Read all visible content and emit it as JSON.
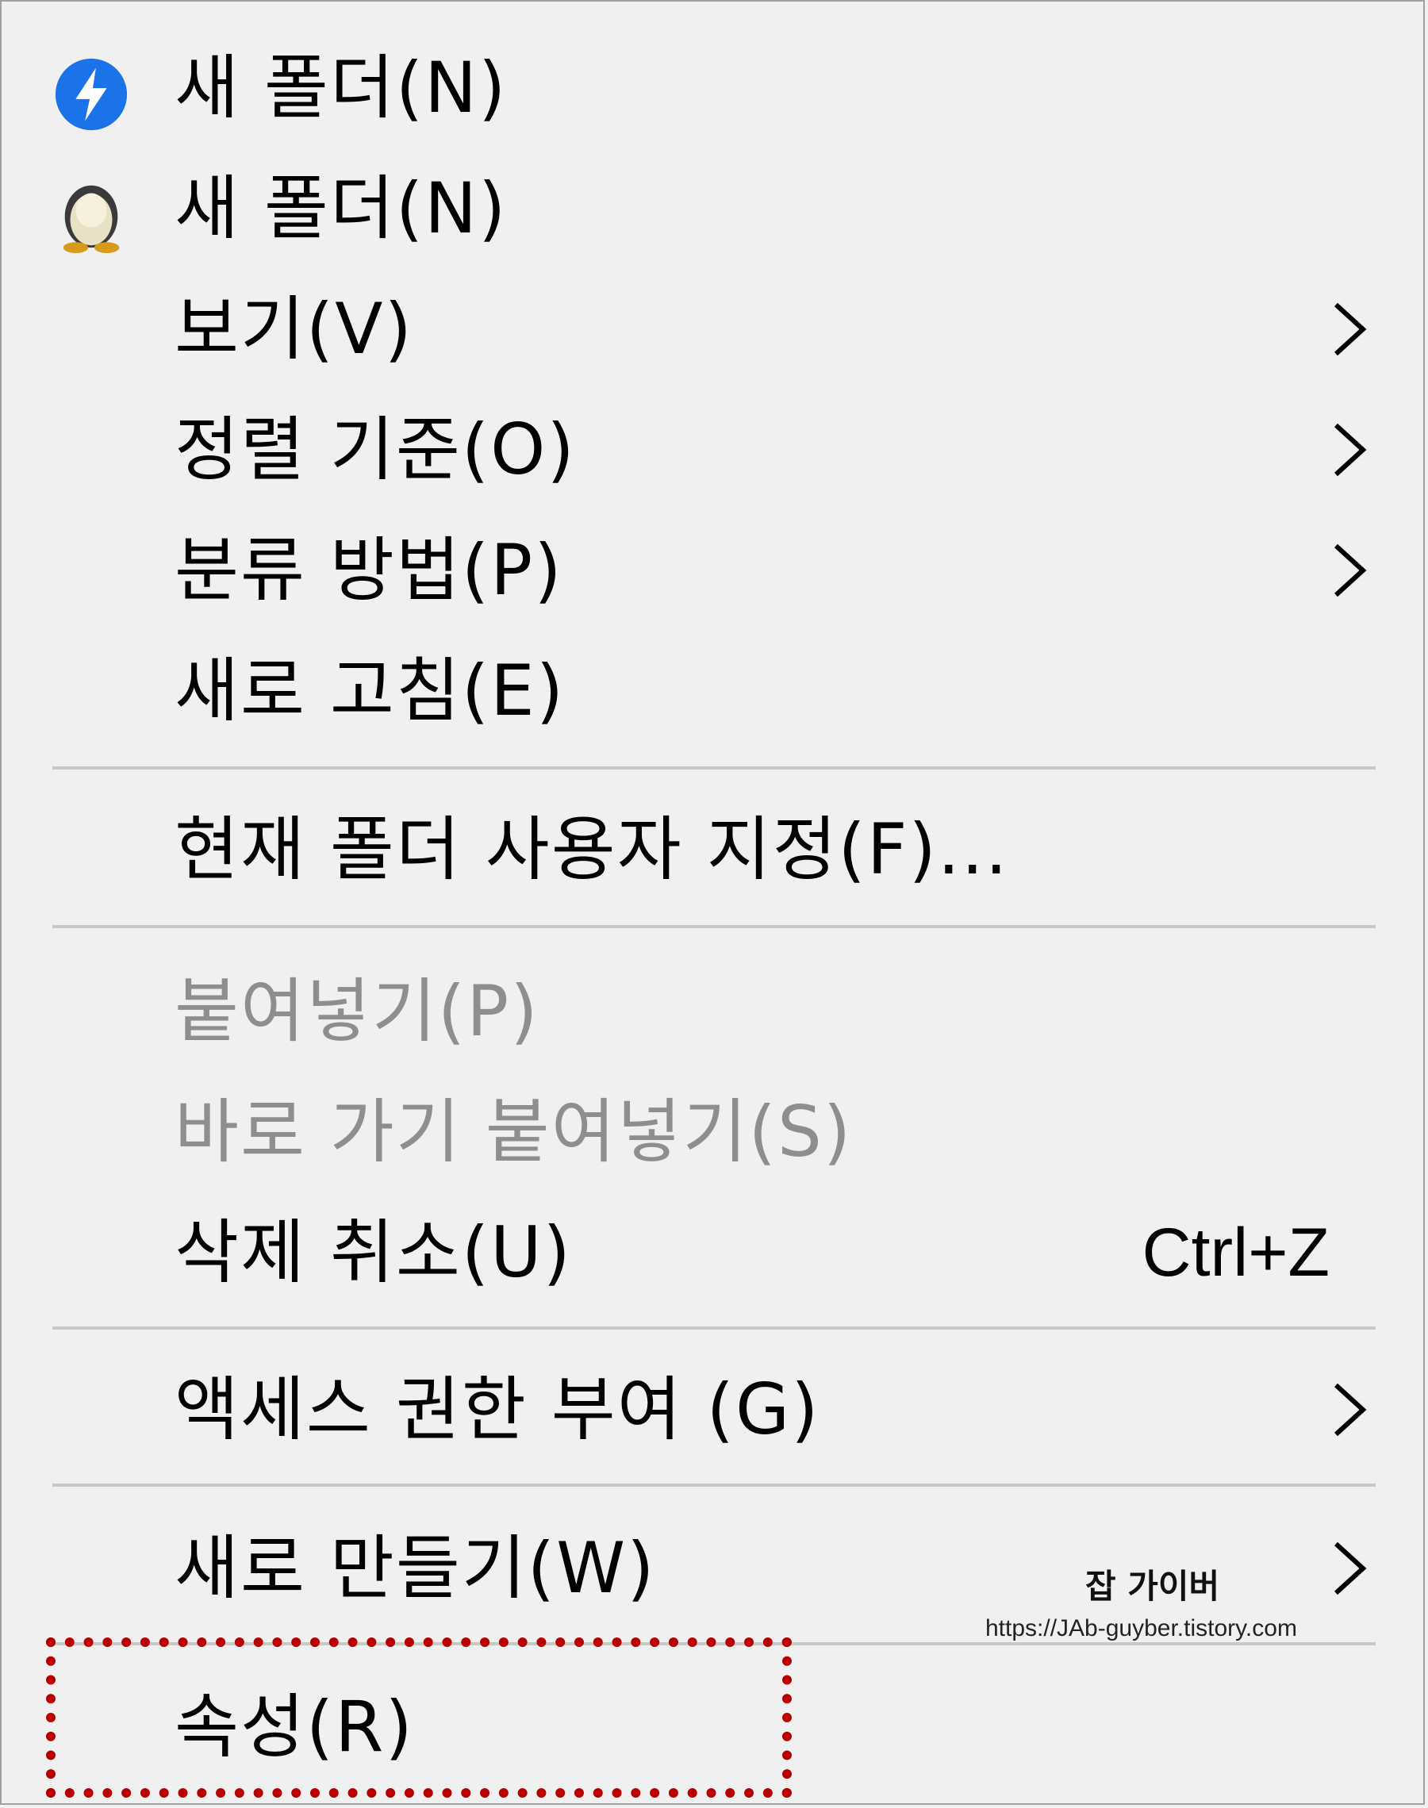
{
  "menu": {
    "items": [
      {
        "label": "새 폴더(N)",
        "icon": "lightning-bolt-icon"
      },
      {
        "label": "새 폴더(N)",
        "icon": "tux-penguin-icon"
      },
      {
        "label": "보기(V)",
        "submenu": true
      },
      {
        "label": "정렬 기준(O)",
        "submenu": true
      },
      {
        "label": "분류 방법(P)",
        "submenu": true
      },
      {
        "label": "새로 고침(E)"
      },
      {
        "label": "현재 폴더 사용자 지정(F)..."
      },
      {
        "label": "붙여넣기(P)",
        "disabled": true
      },
      {
        "label": "바로 가기 붙여넣기(S)",
        "disabled": true
      },
      {
        "label": "삭제 취소(U)",
        "shortcut": "Ctrl+Z"
      },
      {
        "label": "액세스 권한 부여 (G)",
        "submenu": true
      },
      {
        "label": "새로 만들기(W)",
        "submenu": true
      },
      {
        "label": "속성(R)"
      }
    ]
  },
  "watermark": {
    "name": "잡 가이버",
    "url": "https://JAb-guyber.tistory.com"
  },
  "colors": {
    "background": "#f0f0f0",
    "disabled_text": "#8e8e8e",
    "separator": "#c8c8c8",
    "highlight_border": "#b80000",
    "icon_blue": "#1a73e8"
  }
}
